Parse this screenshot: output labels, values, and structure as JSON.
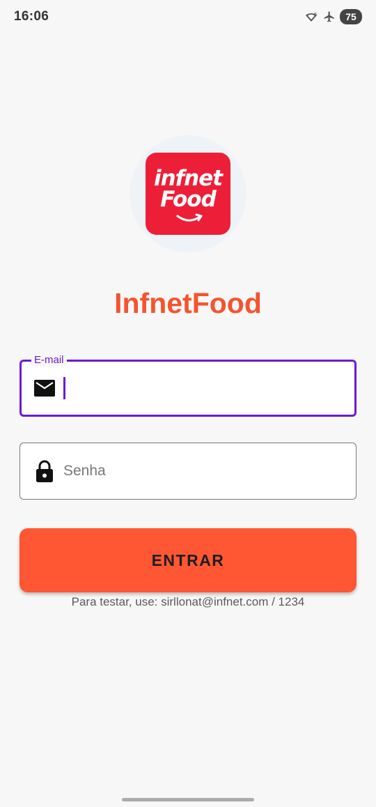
{
  "status_bar": {
    "time": "16:06",
    "battery": "75",
    "icons": [
      "wifi-icon",
      "airplane-icon",
      "battery-icon"
    ]
  },
  "logo": {
    "line1": "infnet",
    "line2": "Food",
    "color": "#ed1f38"
  },
  "app_title": "InfnetFood",
  "email_field": {
    "label": "E-mail",
    "value": "",
    "icon": "mail-icon",
    "focus_color": "#6a1bd0"
  },
  "password_field": {
    "placeholder": "Senha",
    "value": "",
    "icon": "lock-icon"
  },
  "submit_button": {
    "label": "ENTRAR",
    "color": "#ff5733"
  },
  "hint_text": "Para testar, use: sirllonat@infnet.com / 1234",
  "accent_title_color": "#f4542f"
}
